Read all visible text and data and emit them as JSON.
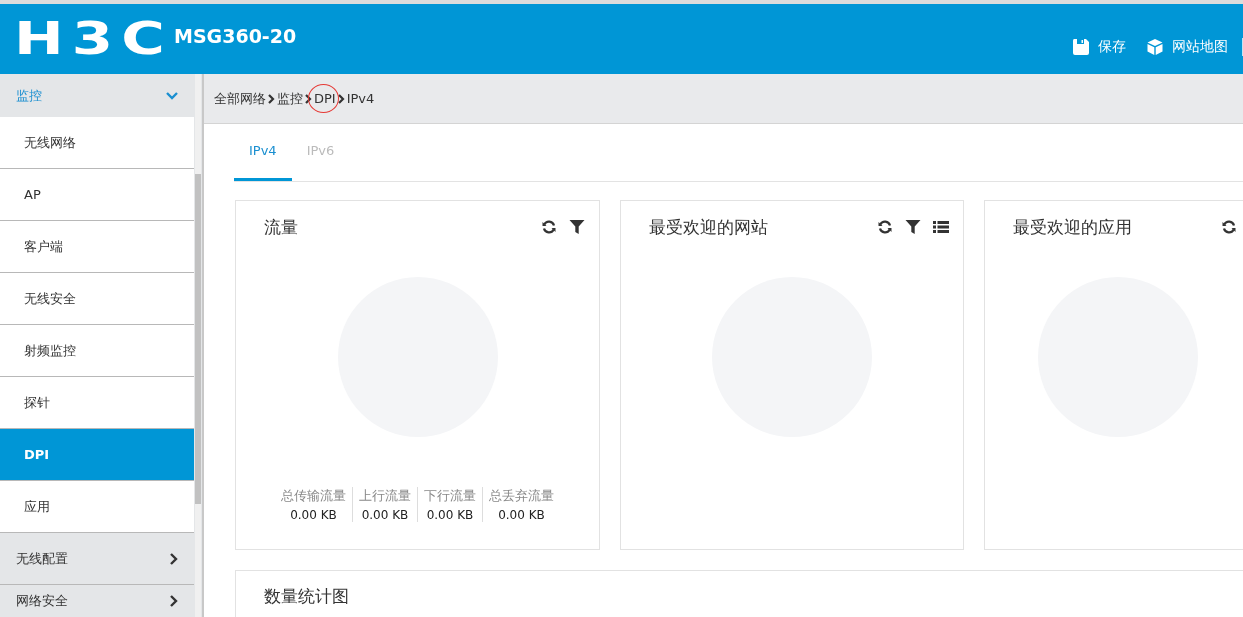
{
  "header": {
    "logo": "H3C",
    "model": "MSG360-20",
    "actions": [
      {
        "kind": "save",
        "label": "保存"
      },
      {
        "kind": "sitemap",
        "label": "网站地图"
      }
    ]
  },
  "sidebar": {
    "groups": [
      {
        "label": "监控",
        "expanded": true,
        "children": [
          {
            "label": "无线网络",
            "selected": false
          },
          {
            "label": "AP",
            "selected": false
          },
          {
            "label": "客户端",
            "selected": false
          },
          {
            "label": "无线安全",
            "selected": false
          },
          {
            "label": "射频监控",
            "selected": false
          },
          {
            "label": "探针",
            "selected": false
          },
          {
            "label": "DPI",
            "selected": true
          },
          {
            "label": "应用",
            "selected": false
          }
        ]
      },
      {
        "label": "无线配置",
        "expanded": false
      },
      {
        "label": "网络安全",
        "expanded": false
      }
    ]
  },
  "breadcrumb": [
    {
      "label": "全部网络",
      "circled": false
    },
    {
      "label": "监控",
      "circled": false
    },
    {
      "label": "DPI",
      "circled": true
    },
    {
      "label": "IPv4",
      "circled": false
    }
  ],
  "tabs": [
    {
      "label": "IPv4",
      "selected": true
    },
    {
      "label": "IPv6",
      "selected": false
    }
  ],
  "cards": [
    {
      "title": "流量",
      "tools": [
        {
          "kind": "refresh"
        },
        {
          "kind": "filter"
        }
      ],
      "stats": [
        {
          "label": "总传输流量",
          "value": "0.00 KB"
        },
        {
          "label": "上行流量",
          "value": "0.00 KB"
        },
        {
          "label": "下行流量",
          "value": "0.00 KB"
        },
        {
          "label": "总丢弃流量",
          "value": "0.00 KB"
        }
      ]
    },
    {
      "title": "最受欢迎的网站",
      "tools": [
        {
          "kind": "refresh"
        },
        {
          "kind": "filter"
        },
        {
          "kind": "list"
        }
      ]
    },
    {
      "title": "最受欢迎的应用",
      "tools": [
        {
          "kind": "refresh"
        }
      ]
    }
  ],
  "bottom_card": {
    "title": "数量统计图"
  }
}
